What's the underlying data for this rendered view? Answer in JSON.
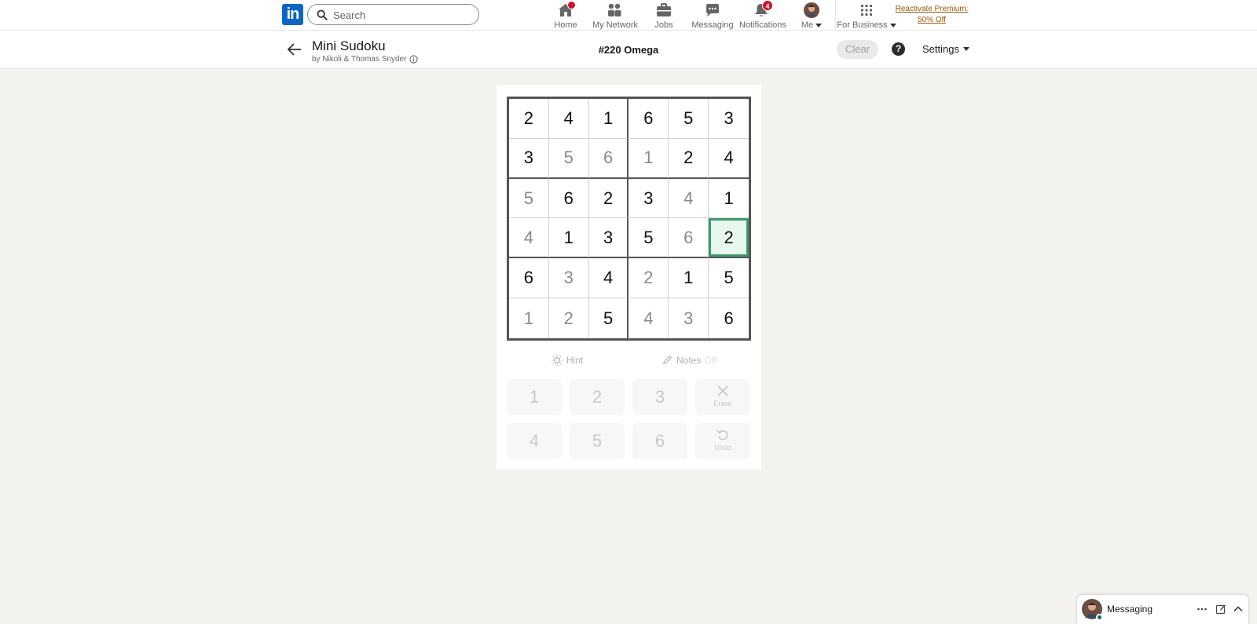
{
  "nav": {
    "logo_text": "in",
    "search_placeholder": "Search",
    "items": [
      {
        "label": "Home",
        "badge": ""
      },
      {
        "label": "My Network",
        "badge": ""
      },
      {
        "label": "Jobs",
        "badge": ""
      },
      {
        "label": "Messaging",
        "badge": ""
      },
      {
        "label": "Notifications",
        "badge": "4"
      },
      {
        "label": "Me",
        "badge": ""
      },
      {
        "label": "For Business",
        "badge": ""
      }
    ],
    "premium_line1": "Reactivate Premium:",
    "premium_line2": "50% Off"
  },
  "game": {
    "title": "Mini Sudoku",
    "byline": "by Nikoli & Thomas Snyder",
    "puzzle_id": "#220 Omega",
    "clear_label": "Clear",
    "help_label": "?",
    "settings_label": "Settings",
    "board": [
      [
        "2",
        "4",
        "1",
        "6",
        "5",
        "3"
      ],
      [
        "3",
        "5",
        "6",
        "1",
        "2",
        "4"
      ],
      [
        "5",
        "6",
        "2",
        "3",
        "4",
        "1"
      ],
      [
        "4",
        "1",
        "3",
        "5",
        "6",
        "2"
      ],
      [
        "6",
        "3",
        "4",
        "2",
        "1",
        "5"
      ],
      [
        "1",
        "2",
        "5",
        "4",
        "3",
        "6"
      ]
    ],
    "hint_label": "Hint",
    "notes_label": "Notes",
    "notes_state": "Off",
    "keypad": [
      "1",
      "2",
      "3",
      "4",
      "5",
      "6"
    ],
    "erase_label": "Erase",
    "undo_label": "Undo"
  },
  "messaging": {
    "label": "Messaging"
  },
  "colors": {
    "brand": "#0a66c2",
    "badge": "#cb112d",
    "selected_border": "#3c9b6a",
    "selected_fill": "#e8f8ee",
    "premium": "#915907"
  }
}
